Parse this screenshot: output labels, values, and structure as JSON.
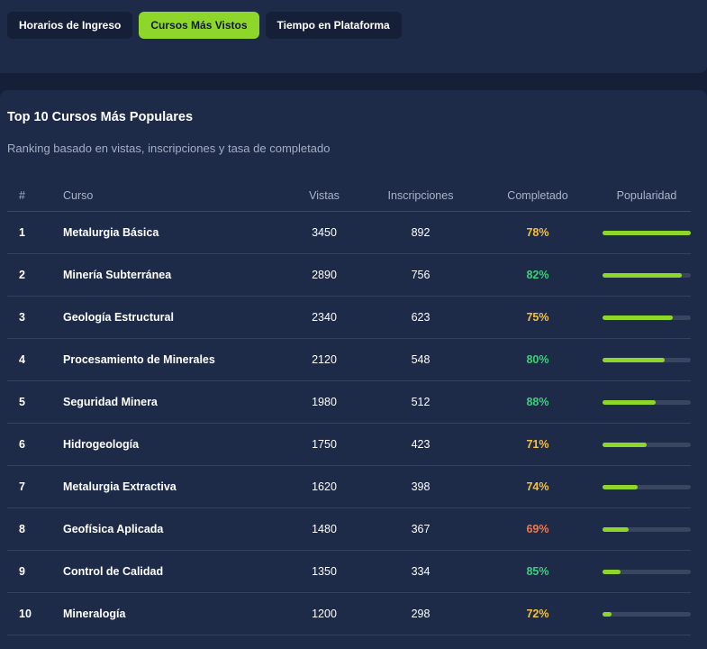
{
  "tabs": [
    {
      "label": "Horarios de Ingreso",
      "active": false
    },
    {
      "label": "Cursos Más Vistos",
      "active": true
    },
    {
      "label": "Tiempo en Plataforma",
      "active": false
    }
  ],
  "colors": {
    "accent": "#8fd62a",
    "yellow": "#f5c13d",
    "green": "#3ecf7a",
    "orange": "#f07a4a"
  },
  "card": {
    "title": "Top 10 Cursos Más Populares",
    "subtitle": "Ranking basado en vistas, inscripciones y tasa de completado"
  },
  "table": {
    "headers": {
      "rank": "#",
      "course": "Curso",
      "views": "Vistas",
      "enrollments": "Inscripciones",
      "completed": "Completado",
      "popularity": "Popularidad"
    },
    "rows": [
      {
        "rank": "1",
        "course": "Metalurgia Básica",
        "views": "3450",
        "enrollments": "892",
        "completed": "78%",
        "completed_color": "#f5c13d",
        "popularity": 1.0
      },
      {
        "rank": "2",
        "course": "Minería Subterránea",
        "views": "2890",
        "enrollments": "756",
        "completed": "82%",
        "completed_color": "#3ecf7a",
        "popularity": 0.9
      },
      {
        "rank": "3",
        "course": "Geología Estructural",
        "views": "2340",
        "enrollments": "623",
        "completed": "75%",
        "completed_color": "#f5c13d",
        "popularity": 0.8
      },
      {
        "rank": "4",
        "course": "Procesamiento de Minerales",
        "views": "2120",
        "enrollments": "548",
        "completed": "80%",
        "completed_color": "#3ecf7a",
        "popularity": 0.7
      },
      {
        "rank": "5",
        "course": "Seguridad Minera",
        "views": "1980",
        "enrollments": "512",
        "completed": "88%",
        "completed_color": "#3ecf7a",
        "popularity": 0.6
      },
      {
        "rank": "6",
        "course": "Hidrogeología",
        "views": "1750",
        "enrollments": "423",
        "completed": "71%",
        "completed_color": "#f5c13d",
        "popularity": 0.5
      },
      {
        "rank": "7",
        "course": "Metalurgia Extractiva",
        "views": "1620",
        "enrollments": "398",
        "completed": "74%",
        "completed_color": "#f5c13d",
        "popularity": 0.4
      },
      {
        "rank": "8",
        "course": "Geofísica Aplicada",
        "views": "1480",
        "enrollments": "367",
        "completed": "69%",
        "completed_color": "#f07a4a",
        "popularity": 0.3
      },
      {
        "rank": "9",
        "course": "Control de Calidad",
        "views": "1350",
        "enrollments": "334",
        "completed": "85%",
        "completed_color": "#3ecf7a",
        "popularity": 0.2
      },
      {
        "rank": "10",
        "course": "Mineralogía",
        "views": "1200",
        "enrollments": "298",
        "completed": "72%",
        "completed_color": "#f5c13d",
        "popularity": 0.1
      }
    ]
  }
}
